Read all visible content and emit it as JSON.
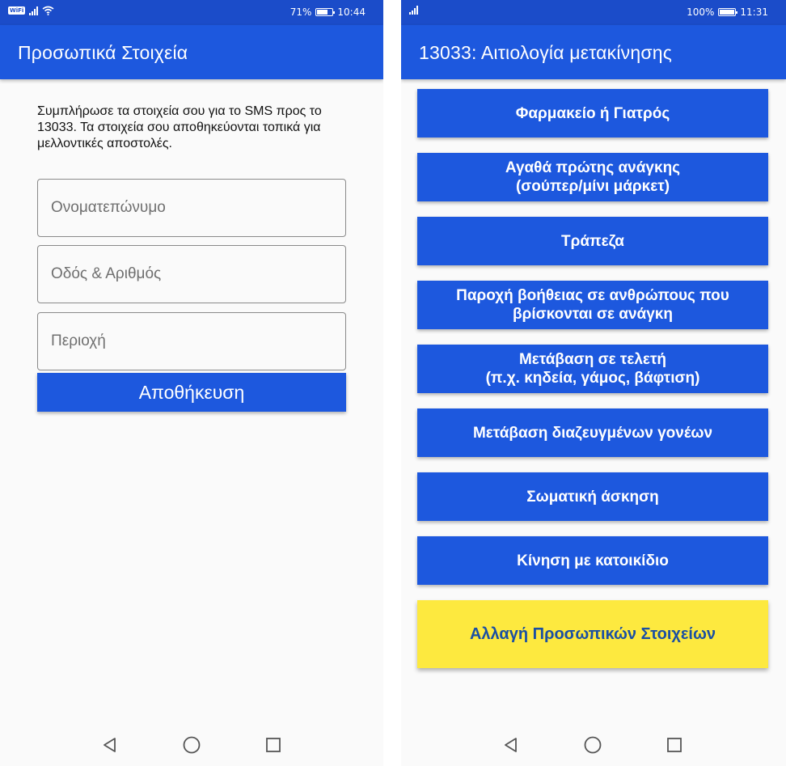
{
  "left_screen": {
    "status": {
      "wifi_badge": "WiFi",
      "battery_text": "71%",
      "battery_level": 0.71,
      "time": "10:44"
    },
    "title": "Προσωπικά Στοιχεία",
    "intro_text": "Συμπλήρωσε τα στοιχεία σου για το SMS προς το 13033. Τα στοιχεία σου αποθηκεύονται τοπικά για μελλοντικές αποστολές.",
    "fields": {
      "name_placeholder": "Ονοματεπώνυμο",
      "address_placeholder": "Οδός & Αριθμός",
      "area_placeholder": "Περιοχή"
    },
    "save_label": "Αποθήκευση"
  },
  "right_screen": {
    "status": {
      "battery_text": "100%",
      "battery_level": 1.0,
      "time": "11:31"
    },
    "title": "13033: Αιτιολογία μετακίνησης",
    "reasons": [
      {
        "line1": "Φαρμακείο ή Γιατρός",
        "line2": ""
      },
      {
        "line1": "Αγαθά πρώτης ανάγκης",
        "line2": "(σούπερ/μίνι μάρκετ)"
      },
      {
        "line1": "Τράπεζα",
        "line2": ""
      },
      {
        "line1": "Παροχή βοήθειας σε ανθρώπους που",
        "line2": "βρίσκονται σε ανάγκη"
      },
      {
        "line1": "Μετάβαση σε τελετή",
        "line2": "(π.χ. κηδεία, γάμος, βάφτιση)"
      },
      {
        "line1": "Μετάβαση διαζευγμένων γονέων",
        "line2": ""
      },
      {
        "line1": "Σωματική άσκηση",
        "line2": ""
      },
      {
        "line1": "Κίνηση με κατοικίδιο",
        "line2": ""
      }
    ],
    "change_label": "Αλλαγή Προσωπικών Στοιχείων"
  },
  "navigation": {
    "back_icon": "back-triangle-icon",
    "home_icon": "home-circle-icon",
    "recents_icon": "recents-square-icon"
  },
  "colors": {
    "status_bar": "#1b4cc9",
    "app_bar": "#1d58de",
    "button": "#1d58de",
    "change_button": "#fde93f",
    "change_text": "#1a4fa3",
    "background": "#fafafa"
  }
}
